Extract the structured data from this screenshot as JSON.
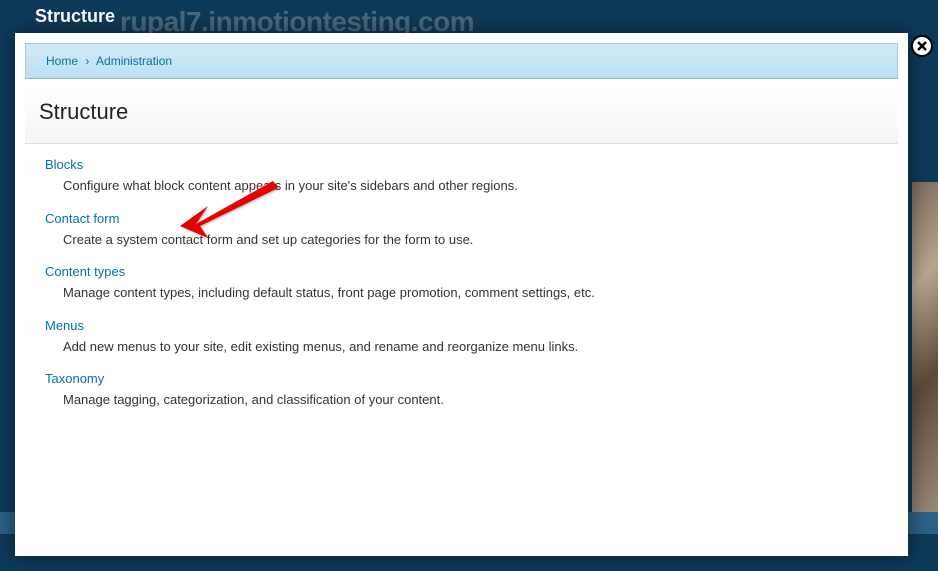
{
  "bg": {
    "url_text": "rupal7.inmotiontesting.com",
    "toolbar_title": "Structure"
  },
  "close_label": "Close",
  "breadcrumb": {
    "home": "Home",
    "sep": "›",
    "admin": "Administration"
  },
  "page": {
    "title": "Structure"
  },
  "list": [
    {
      "title": "Blocks",
      "desc": "Configure what block content appears in your site's sidebars and other regions."
    },
    {
      "title": "Contact form",
      "desc": "Create a system contact form and set up categories for the form to use."
    },
    {
      "title": "Content types",
      "desc": "Manage content types, including default status, front page promotion, comment settings, etc."
    },
    {
      "title": "Menus",
      "desc": "Add new menus to your site, edit existing menus, and rename and reorganize menu links."
    },
    {
      "title": "Taxonomy",
      "desc": "Manage tagging, categorization, and classification of your content."
    }
  ]
}
